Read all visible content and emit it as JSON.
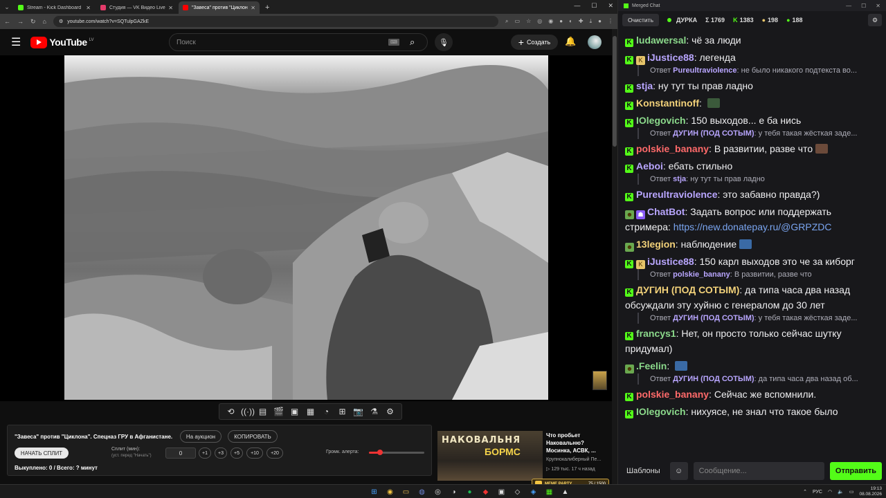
{
  "browser": {
    "tabs": [
      {
        "title": "Stream - Kick Dashboard",
        "color": "#53fc18",
        "active": false
      },
      {
        "title": "Студия — VK Видео Live",
        "color": "#e33b6a",
        "active": false
      },
      {
        "title": "\"Завеса\" против \"Циклона\". Спецназ ГРУ в Афганистане.",
        "color": "#ff0000",
        "active": true
      }
    ],
    "new_tab": "+",
    "url": "youtube.com/watch?v=SQTulpGAZkE"
  },
  "youtube": {
    "logo": "YouTube",
    "region": "LV",
    "search_placeholder": "Поиск",
    "create_label": "Создать"
  },
  "panel": {
    "title": "\"Завеса\" против \"Циклона\". Спецназ ГРУ в Афганистане.",
    "auction_label": "На аукцион",
    "copy_label": "КОПИРОВАТЬ",
    "start_label": "НАЧАТЬ СПЛИТ",
    "split_label": "Сплит (мин):",
    "split_hint": "(уст. перед \"Начать\")",
    "split_value": "0",
    "increments": [
      "+1",
      "+3",
      "+5",
      "+10",
      "+20"
    ],
    "bought": "Выкуплено: 0 / Всего: ? минут",
    "volume_label": "Громк. алерта:",
    "volume_fraction": 0.2
  },
  "recommended": {
    "thumb_text1": "НАКОВАЛЬНЯ",
    "thumb_text2": "БОРМС",
    "title": "Что пробьет Наковальню? Мосинка, АСВК, ...",
    "channel": "Крупнокалиберный Пе...",
    "meta": "129 тыс.  17 ч назад"
  },
  "meme_bar": {
    "title": "MEME PARTY",
    "count": "75 / 1500"
  },
  "chat": {
    "window_title": "Merged Chat",
    "clear_label": "Очистить",
    "streamer": "ДУРКА",
    "total": "Σ 1769",
    "kick_count": "1383",
    "vk_count": "198",
    "yt_count": "188",
    "messages": [
      {
        "kind": "msg",
        "badges": [
          "kick"
        ],
        "user": "ludawersal",
        "color": "#8bd98b",
        "text": "чё за люди"
      },
      {
        "kind": "msg",
        "badges": [
          "kick",
          "sub"
        ],
        "user": "iJustice88",
        "color": "#b9a6ff",
        "text": "легенда"
      },
      {
        "kind": "reply",
        "prefix": "Ответ",
        "user": "Pureultraviolence",
        "color": "#b9a6ff",
        "text": "не было никакого подтекста во..."
      },
      {
        "kind": "msg",
        "badges": [
          "kick"
        ],
        "user": "stja",
        "color": "#b9a6ff",
        "text": "ну тут ты прав ладно"
      },
      {
        "kind": "msg",
        "badges": [
          "kick"
        ],
        "user": "Konstantinoff",
        "color": "#f3d27a",
        "text": "",
        "emote": "#3b5a3b"
      },
      {
        "kind": "msg",
        "badges": [
          "kick"
        ],
        "user": "IOlegovich",
        "color": "#8bd98b",
        "text": "150 выходов... е ба нись"
      },
      {
        "kind": "reply",
        "prefix": "Ответ",
        "user": "ДУГИН (ПОД СОТЫМ)",
        "color": "#b9a6ff",
        "text": "у тебя такая жёсткая заде..."
      },
      {
        "kind": "msg",
        "badges": [
          "kick"
        ],
        "user": "polskie_banany",
        "color": "#ff6a6a",
        "text": "В развитии, разве что",
        "emote": "#6b4a3a"
      },
      {
        "kind": "msg",
        "badges": [
          "kick"
        ],
        "user": "Aeboi",
        "color": "#b9a6ff",
        "text": "ебать стильно"
      },
      {
        "kind": "reply",
        "prefix": "Ответ",
        "user": "stja",
        "color": "#b9a6ff",
        "text": "ну тут ты прав ладно"
      },
      {
        "kind": "msg",
        "badges": [
          "kick"
        ],
        "user": "Pureultraviolence",
        "color": "#b9a6ff",
        "text": "это забавно правда?)"
      },
      {
        "kind": "msg",
        "badges": [
          "pepe",
          "bot"
        ],
        "user": "ChatBot",
        "color": "#b9a6ff",
        "text": "Задать вопрос или поддержать стримера: ",
        "link": "https://new.donatepay.ru/@GRPZDC"
      },
      {
        "kind": "msg",
        "badges": [
          "pepe"
        ],
        "user": "13legion",
        "color": "#f3d27a",
        "text": "наблюдение",
        "emote": "#3a6aa5"
      },
      {
        "kind": "msg",
        "badges": [
          "kick",
          "sub"
        ],
        "user": "iJustice88",
        "color": "#b9a6ff",
        "text": "150 карл выходов это че за киборг"
      },
      {
        "kind": "reply",
        "prefix": "Ответ",
        "user": "polskie_banany",
        "color": "#b9a6ff",
        "text": "В развитии, разве что",
        "emote": "#6b4a3a"
      },
      {
        "kind": "msg",
        "badges": [
          "kick"
        ],
        "user": "ДУГИН (ПОД СОТЫМ)",
        "color": "#f3d27a",
        "text": "да типа часа два назад обсуждали эту хуйню с генералом до 30 лет"
      },
      {
        "kind": "reply",
        "prefix": "Ответ",
        "user": "ДУГИН (ПОД СОТЫМ)",
        "color": "#b9a6ff",
        "text": "у тебя такая жёсткая заде..."
      },
      {
        "kind": "msg",
        "badges": [
          "kick"
        ],
        "user": "francys1",
        "color": "#8bd98b",
        "text": "Нет, он просто только сейчас шутку придумал)"
      },
      {
        "kind": "msg",
        "badges": [
          "pepe"
        ],
        "user": ".Feelin",
        "color": "#8bd98b",
        "text": "",
        "emote": "#3a6aa5"
      },
      {
        "kind": "reply",
        "prefix": "Ответ",
        "user": "ДУГИН (ПОД СОТЫМ)",
        "color": "#b9a6ff",
        "text": "да типа часа два назад об..."
      },
      {
        "kind": "msg",
        "badges": [
          "kick"
        ],
        "user": "polskie_banany",
        "color": "#ff6a6a",
        "text": "Сейчас же вспомнили."
      },
      {
        "kind": "msg",
        "badges": [
          "kick"
        ],
        "user": "IOlegovich",
        "color": "#8bd98b",
        "text": "нихуясе, не знал что такое было"
      }
    ],
    "templates_label": "Шаблоны",
    "input_placeholder": "Сообщение...",
    "send_label": "Отправить"
  },
  "taskbar": {
    "lang": "РУС",
    "time": "19:13",
    "date": "08.08.2026"
  }
}
